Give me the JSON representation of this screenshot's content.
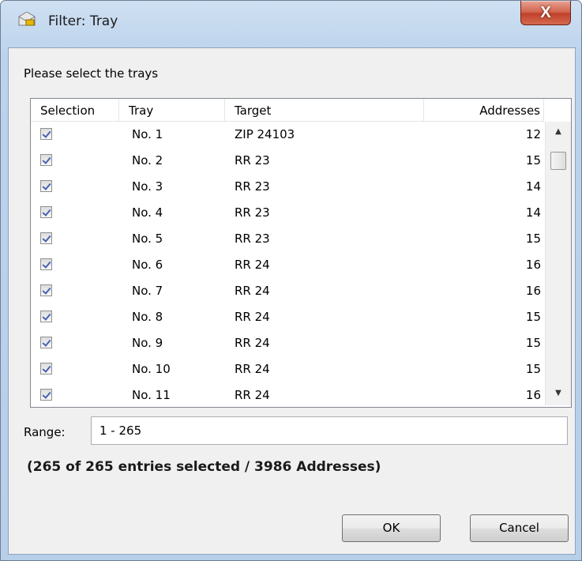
{
  "window": {
    "title": "Filter: Tray",
    "close_label": "X"
  },
  "prompt": "Please select the trays",
  "columns": {
    "selection": "Selection",
    "tray": "Tray",
    "target": "Target",
    "addresses": "Addresses"
  },
  "rows": [
    {
      "selected": true,
      "tray": "No. 1",
      "target": "ZIP 24103",
      "addresses": "12"
    },
    {
      "selected": true,
      "tray": "No. 2",
      "target": "RR 23",
      "addresses": "15"
    },
    {
      "selected": true,
      "tray": "No. 3",
      "target": "RR 23",
      "addresses": "14"
    },
    {
      "selected": true,
      "tray": "No. 4",
      "target": "RR 23",
      "addresses": "14"
    },
    {
      "selected": true,
      "tray": "No. 5",
      "target": "RR 23",
      "addresses": "15"
    },
    {
      "selected": true,
      "tray": "No. 6",
      "target": "RR 24",
      "addresses": "16"
    },
    {
      "selected": true,
      "tray": "No. 7",
      "target": "RR 24",
      "addresses": "16"
    },
    {
      "selected": true,
      "tray": "No. 8",
      "target": "RR 24",
      "addresses": "15"
    },
    {
      "selected": true,
      "tray": "No. 9",
      "target": "RR 24",
      "addresses": "15"
    },
    {
      "selected": true,
      "tray": "No. 10",
      "target": "RR 24",
      "addresses": "15"
    },
    {
      "selected": true,
      "tray": "No. 11",
      "target": "RR 24",
      "addresses": "16"
    }
  ],
  "range": {
    "label": "Range:",
    "value": "1 - 265"
  },
  "summary": "(265 of 265 entries selected / 3986 Addresses)",
  "buttons": {
    "ok": "OK",
    "cancel": "Cancel"
  },
  "icons": {
    "app": "envelope-key-icon",
    "close": "close-icon",
    "scroll_up": "scroll-up-icon",
    "scroll_down": "scroll-down-icon"
  }
}
